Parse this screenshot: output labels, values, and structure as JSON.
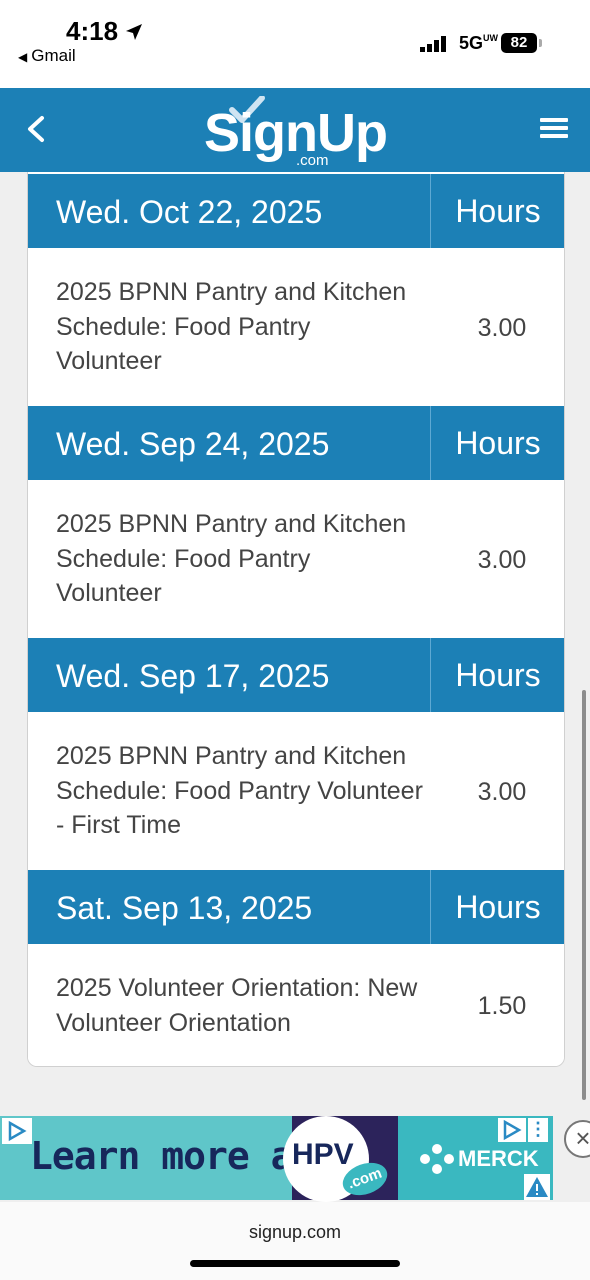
{
  "status_bar": {
    "time": "4:18",
    "back_app": "Gmail",
    "network": "5G",
    "network_suffix": "UW",
    "battery": "82"
  },
  "header": {
    "logo": "SignUp",
    "logo_suffix": ".com"
  },
  "entries": [
    {
      "date": "Wed. Oct 22, 2025",
      "hours_label": "Hours",
      "description": "2025 BPNN Pantry and Kitchen Schedule: Food Pantry Volunteer",
      "hours": "3.00"
    },
    {
      "date": "Wed. Sep 24, 2025",
      "hours_label": "Hours",
      "description": "2025 BPNN Pantry and Kitchen Schedule: Food Pantry Volunteer",
      "hours": "3.00"
    },
    {
      "date": "Wed. Sep 17, 2025",
      "hours_label": "Hours",
      "description": "2025 BPNN Pantry and Kitchen Schedule: Food Pantry Volunteer - First Time",
      "hours": "3.00"
    },
    {
      "date": "Sat. Sep 13, 2025",
      "hours_label": "Hours",
      "description": "2025 Volunteer Orientation: New Volunteer Orientation",
      "hours": "1.50"
    }
  ],
  "ad": {
    "text": "Learn more at",
    "hpv": "HPV",
    "com": ".com",
    "brand": "MERCK"
  },
  "footer": {
    "url": "signup.com"
  },
  "colors": {
    "brand_blue": "#1c80b6",
    "ad_teal": "#5fc6c9"
  }
}
